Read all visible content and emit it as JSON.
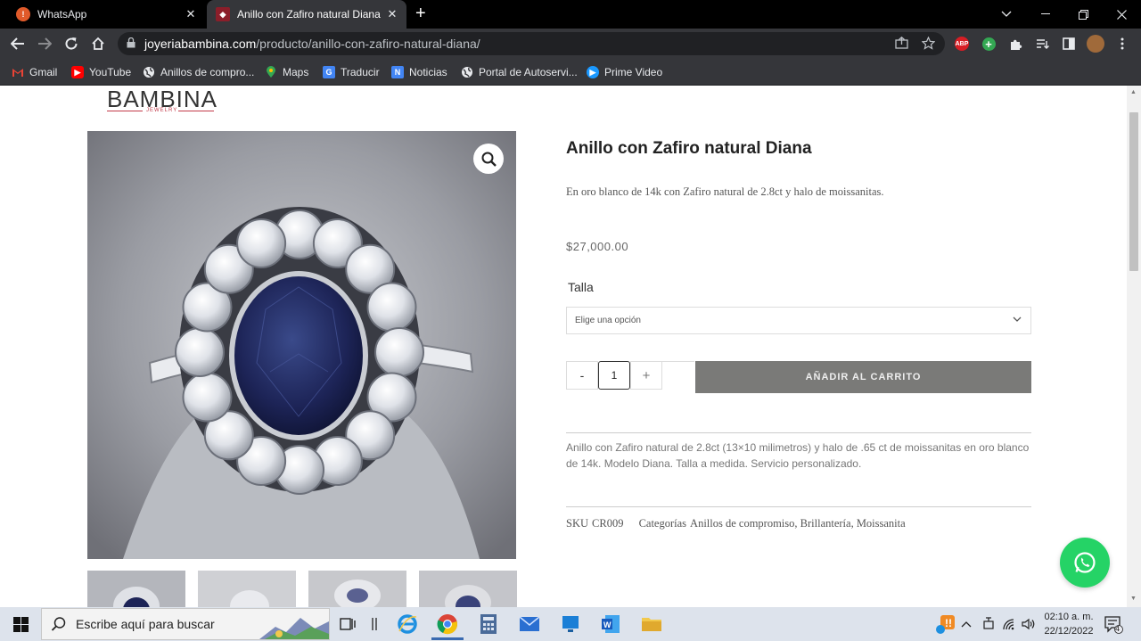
{
  "browser": {
    "tabs": [
      {
        "title": "WhatsApp",
        "close": "✕"
      },
      {
        "title": "Anillo con Zafiro natural Diana | J",
        "close": "✕"
      }
    ],
    "new_tab": "+",
    "url_host": "joyeriabambina.com",
    "url_path": "/producto/anillo-con-zafiro-natural-diana/",
    "bookmarks": [
      {
        "label": "Gmail",
        "icon": "gmail-icon",
        "color": "#ea4335"
      },
      {
        "label": "YouTube",
        "icon": "youtube-icon",
        "color": "#ff0000"
      },
      {
        "label": "Anillos de compro...",
        "icon": "globe-icon",
        "color": "#e8eaed"
      },
      {
        "label": "Maps",
        "icon": "maps-icon",
        "color": "#34a853"
      },
      {
        "label": "Traducir",
        "icon": "translate-icon",
        "color": "#4285f4"
      },
      {
        "label": "Noticias",
        "icon": "news-icon",
        "color": "#4285f4"
      },
      {
        "label": "Portal de Autoservi...",
        "icon": "globe-icon",
        "color": "#e8eaed"
      },
      {
        "label": "Prime Video",
        "icon": "prime-video-icon",
        "color": "#1a98ff"
      }
    ],
    "extensions": {
      "abp": "ABP"
    }
  },
  "site": {
    "logo_text": "BAMBINA",
    "logo_sub": "JEWELRY"
  },
  "product": {
    "title": "Anillo con Zafiro natural Diana",
    "short_description": "En oro blanco de 14k con Zafiro natural de 2.8ct y halo de moissanitas.",
    "price": "$27,000.00",
    "size_label": "Talla",
    "size_select": "Elige una opción",
    "qty_minus": "-",
    "qty_value": "1",
    "qty_plus": "+",
    "add_to_cart": "AÑADIR AL CARRITO",
    "description": "Anillo con Zafiro natural de 2.8ct (13×10 milimetros) y halo de .65 ct de moissanitas en oro blanco de 14k. Modelo Diana. Talla a medida. Servicio personalizado.",
    "sku_label": "SKU",
    "sku": "CR009",
    "categories_label": "Categorías",
    "categories": "Anillos de compromiso, Brillantería, Moissanita"
  },
  "taskbar": {
    "search_placeholder": "Escribe aquí para buscar",
    "time": "02:10 a. m.",
    "date": "22/12/2022",
    "notifications": "4"
  },
  "colors": {
    "accent_cart": "#7a7a78",
    "whatsapp": "#25d366",
    "chrome_dark": "#35363a"
  }
}
